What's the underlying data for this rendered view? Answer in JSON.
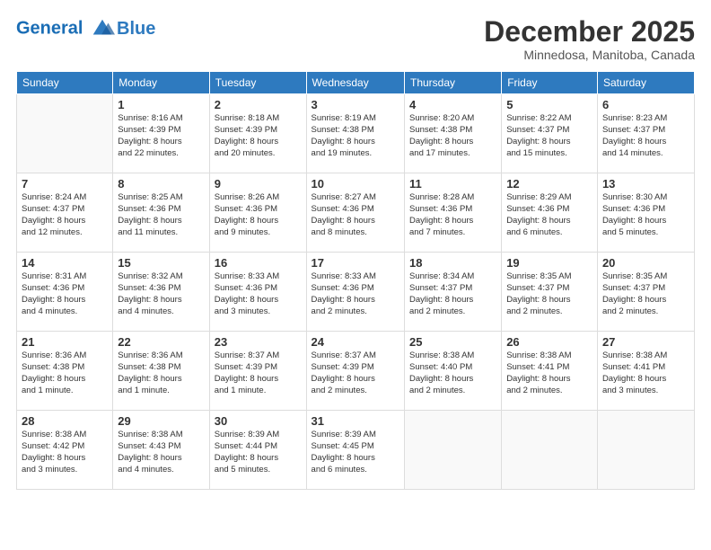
{
  "header": {
    "logo_line1": "General",
    "logo_line2": "Blue",
    "month": "December 2025",
    "location": "Minnedosa, Manitoba, Canada"
  },
  "weekdays": [
    "Sunday",
    "Monday",
    "Tuesday",
    "Wednesday",
    "Thursday",
    "Friday",
    "Saturday"
  ],
  "weeks": [
    [
      {
        "day": "",
        "info": ""
      },
      {
        "day": "1",
        "info": "Sunrise: 8:16 AM\nSunset: 4:39 PM\nDaylight: 8 hours\nand 22 minutes."
      },
      {
        "day": "2",
        "info": "Sunrise: 8:18 AM\nSunset: 4:39 PM\nDaylight: 8 hours\nand 20 minutes."
      },
      {
        "day": "3",
        "info": "Sunrise: 8:19 AM\nSunset: 4:38 PM\nDaylight: 8 hours\nand 19 minutes."
      },
      {
        "day": "4",
        "info": "Sunrise: 8:20 AM\nSunset: 4:38 PM\nDaylight: 8 hours\nand 17 minutes."
      },
      {
        "day": "5",
        "info": "Sunrise: 8:22 AM\nSunset: 4:37 PM\nDaylight: 8 hours\nand 15 minutes."
      },
      {
        "day": "6",
        "info": "Sunrise: 8:23 AM\nSunset: 4:37 PM\nDaylight: 8 hours\nand 14 minutes."
      }
    ],
    [
      {
        "day": "7",
        "info": "Sunrise: 8:24 AM\nSunset: 4:37 PM\nDaylight: 8 hours\nand 12 minutes."
      },
      {
        "day": "8",
        "info": "Sunrise: 8:25 AM\nSunset: 4:36 PM\nDaylight: 8 hours\nand 11 minutes."
      },
      {
        "day": "9",
        "info": "Sunrise: 8:26 AM\nSunset: 4:36 PM\nDaylight: 8 hours\nand 9 minutes."
      },
      {
        "day": "10",
        "info": "Sunrise: 8:27 AM\nSunset: 4:36 PM\nDaylight: 8 hours\nand 8 minutes."
      },
      {
        "day": "11",
        "info": "Sunrise: 8:28 AM\nSunset: 4:36 PM\nDaylight: 8 hours\nand 7 minutes."
      },
      {
        "day": "12",
        "info": "Sunrise: 8:29 AM\nSunset: 4:36 PM\nDaylight: 8 hours\nand 6 minutes."
      },
      {
        "day": "13",
        "info": "Sunrise: 8:30 AM\nSunset: 4:36 PM\nDaylight: 8 hours\nand 5 minutes."
      }
    ],
    [
      {
        "day": "14",
        "info": "Sunrise: 8:31 AM\nSunset: 4:36 PM\nDaylight: 8 hours\nand 4 minutes."
      },
      {
        "day": "15",
        "info": "Sunrise: 8:32 AM\nSunset: 4:36 PM\nDaylight: 8 hours\nand 4 minutes."
      },
      {
        "day": "16",
        "info": "Sunrise: 8:33 AM\nSunset: 4:36 PM\nDaylight: 8 hours\nand 3 minutes."
      },
      {
        "day": "17",
        "info": "Sunrise: 8:33 AM\nSunset: 4:36 PM\nDaylight: 8 hours\nand 2 minutes."
      },
      {
        "day": "18",
        "info": "Sunrise: 8:34 AM\nSunset: 4:37 PM\nDaylight: 8 hours\nand 2 minutes."
      },
      {
        "day": "19",
        "info": "Sunrise: 8:35 AM\nSunset: 4:37 PM\nDaylight: 8 hours\nand 2 minutes."
      },
      {
        "day": "20",
        "info": "Sunrise: 8:35 AM\nSunset: 4:37 PM\nDaylight: 8 hours\nand 2 minutes."
      }
    ],
    [
      {
        "day": "21",
        "info": "Sunrise: 8:36 AM\nSunset: 4:38 PM\nDaylight: 8 hours\nand 1 minute."
      },
      {
        "day": "22",
        "info": "Sunrise: 8:36 AM\nSunset: 4:38 PM\nDaylight: 8 hours\nand 1 minute."
      },
      {
        "day": "23",
        "info": "Sunrise: 8:37 AM\nSunset: 4:39 PM\nDaylight: 8 hours\nand 1 minute."
      },
      {
        "day": "24",
        "info": "Sunrise: 8:37 AM\nSunset: 4:39 PM\nDaylight: 8 hours\nand 2 minutes."
      },
      {
        "day": "25",
        "info": "Sunrise: 8:38 AM\nSunset: 4:40 PM\nDaylight: 8 hours\nand 2 minutes."
      },
      {
        "day": "26",
        "info": "Sunrise: 8:38 AM\nSunset: 4:41 PM\nDaylight: 8 hours\nand 2 minutes."
      },
      {
        "day": "27",
        "info": "Sunrise: 8:38 AM\nSunset: 4:41 PM\nDaylight: 8 hours\nand 3 minutes."
      }
    ],
    [
      {
        "day": "28",
        "info": "Sunrise: 8:38 AM\nSunset: 4:42 PM\nDaylight: 8 hours\nand 3 minutes."
      },
      {
        "day": "29",
        "info": "Sunrise: 8:38 AM\nSunset: 4:43 PM\nDaylight: 8 hours\nand 4 minutes."
      },
      {
        "day": "30",
        "info": "Sunrise: 8:39 AM\nSunset: 4:44 PM\nDaylight: 8 hours\nand 5 minutes."
      },
      {
        "day": "31",
        "info": "Sunrise: 8:39 AM\nSunset: 4:45 PM\nDaylight: 8 hours\nand 6 minutes."
      },
      {
        "day": "",
        "info": ""
      },
      {
        "day": "",
        "info": ""
      },
      {
        "day": "",
        "info": ""
      }
    ]
  ]
}
